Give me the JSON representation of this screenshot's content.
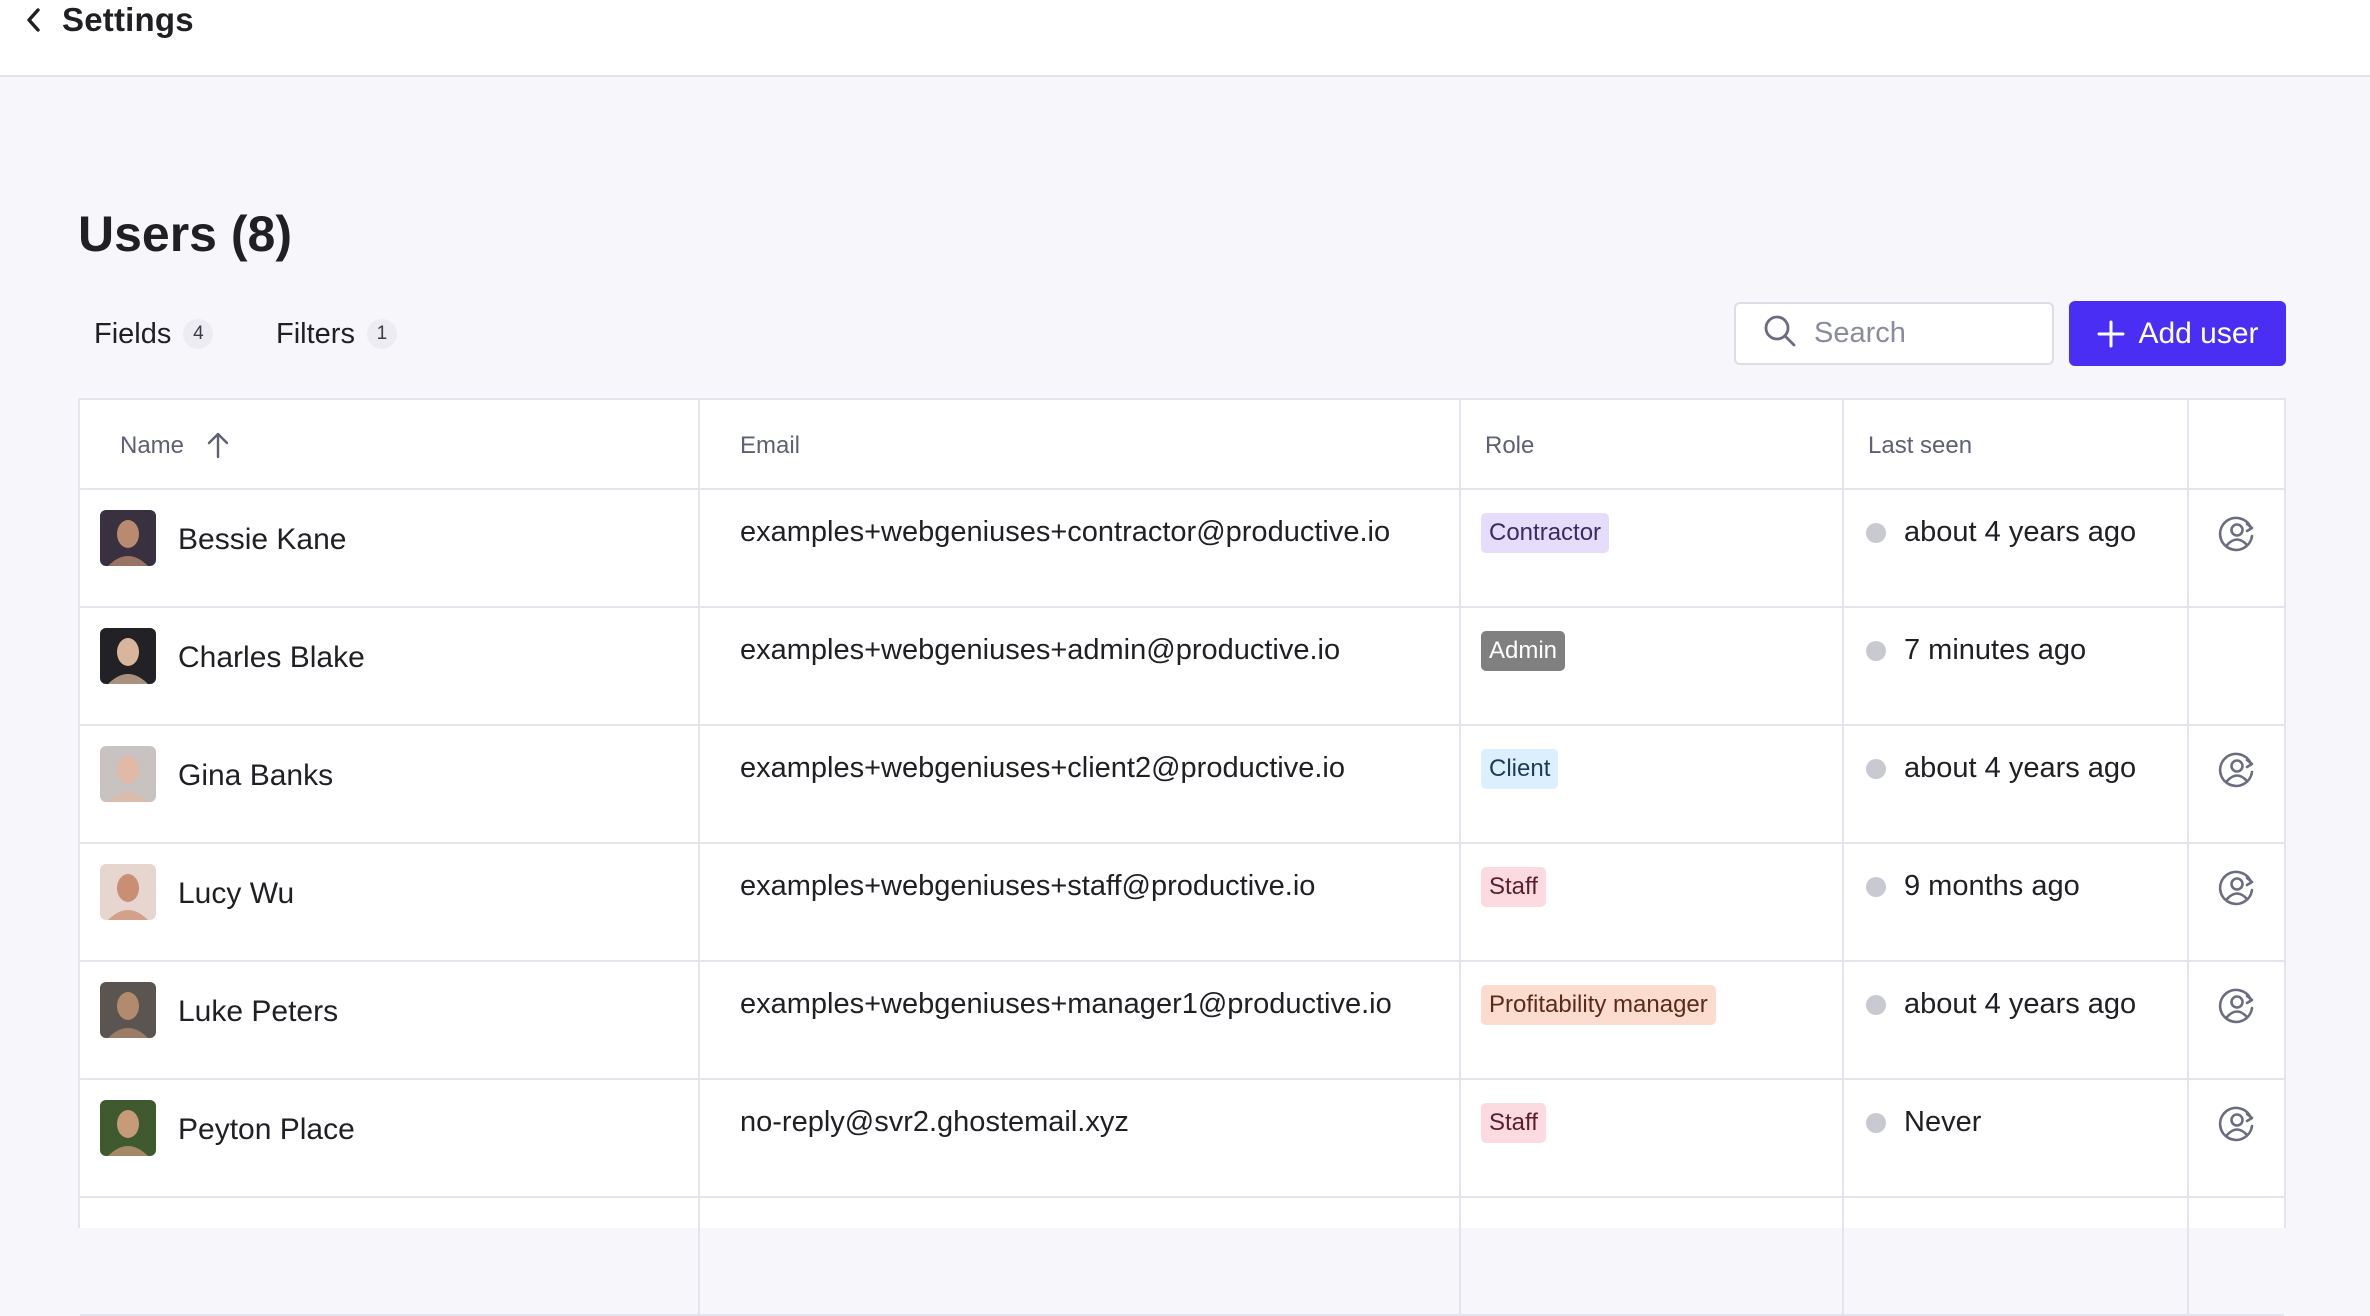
{
  "header": {
    "back_label": "Settings"
  },
  "page": {
    "title": "Users (8)"
  },
  "toolbar": {
    "fields_label": "Fields",
    "fields_count": "4",
    "filters_label": "Filters",
    "filters_count": "1",
    "search_placeholder": "Search",
    "add_user_label": "Add user"
  },
  "table": {
    "columns": {
      "name": "Name",
      "email": "Email",
      "role": "Role",
      "last_seen": "Last seen"
    },
    "sort": {
      "column": "Name",
      "direction": "ascending"
    },
    "rows": [
      {
        "name": "Bessie Kane",
        "email": "examples+webgeniuses+contractor@productive.io",
        "role": "Contractor",
        "role_bg": "#e6dcfb",
        "role_fg": "#3b2a66",
        "last_seen": "about 4 years ago",
        "action_icon": "user-swap-icon",
        "avatar_bg": "#3a3140",
        "avatar_skin": "#b98a6f"
      },
      {
        "name": "Charles Blake",
        "email": "examples+webgeniuses+admin@productive.io",
        "role": "Admin",
        "role_bg": "#808080",
        "role_fg": "#ffffff",
        "last_seen": "7 minutes ago",
        "action_icon": "",
        "avatar_bg": "#222226",
        "avatar_skin": "#d9b59b"
      },
      {
        "name": "Gina Banks",
        "email": "examples+webgeniuses+client2@productive.io",
        "role": "Client",
        "role_bg": "#dcefff",
        "role_fg": "#1d3a5a",
        "last_seen": "about 4 years ago",
        "action_icon": "user-swap-icon",
        "avatar_bg": "#c8c2c0",
        "avatar_skin": "#e2b9a6"
      },
      {
        "name": "Lucy Wu",
        "email": "examples+webgeniuses+staff@productive.io",
        "role": "Staff",
        "role_bg": "#fbdbe1",
        "role_fg": "#5b1d2a",
        "last_seen": "9 months ago",
        "action_icon": "user-swap-icon",
        "avatar_bg": "#e7d6cf",
        "avatar_skin": "#c98f74"
      },
      {
        "name": "Luke Peters",
        "email": "examples+webgeniuses+manager1@productive.io",
        "role": "Profitability manager",
        "role_bg": "#fbdccf",
        "role_fg": "#5b2a1a",
        "last_seen": "about 4 years ago",
        "action_icon": "user-swap-icon",
        "avatar_bg": "#5a5550",
        "avatar_skin": "#b28a6e"
      },
      {
        "name": "Peyton Place",
        "email": "no-reply@svr2.ghostemail.xyz",
        "role": "Staff",
        "role_bg": "#fbdbe1",
        "role_fg": "#5b1d2a",
        "last_seen": "Never",
        "action_icon": "user-swap-icon",
        "avatar_bg": "#3e5a2e",
        "avatar_skin": "#c79a7a"
      }
    ]
  },
  "colors": {
    "accent": "#4b2ef3",
    "border": "#e3e4ec",
    "page_bg": "#f7f7fb",
    "status_dot": "#c9c9d1"
  }
}
